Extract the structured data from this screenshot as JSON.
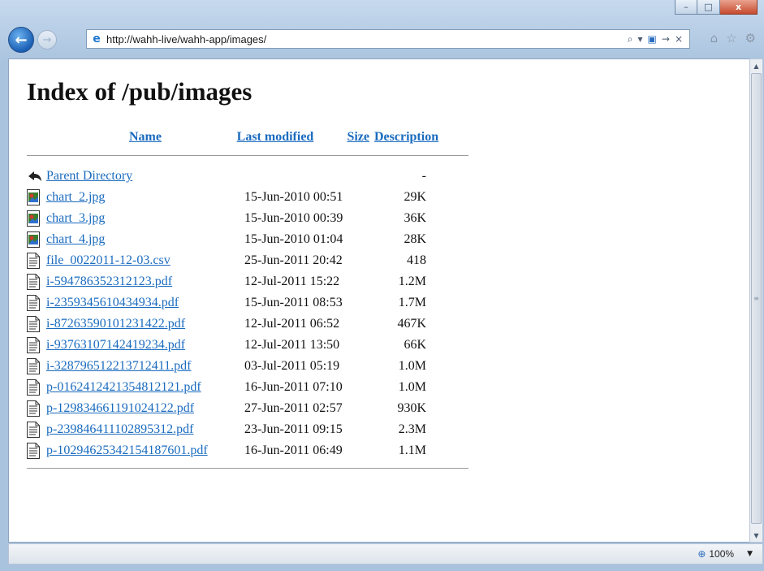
{
  "window": {
    "controls": {
      "minimize": "–",
      "maximize": "□",
      "close": "x"
    }
  },
  "nav": {
    "back_glyph": "←",
    "forward_glyph": "→",
    "address": "http://wahh-live/wahh-app/images/",
    "search_glyph": "⌕",
    "compat_glyph": "▾",
    "refresh_glyph": "→",
    "stop_glyph": "×",
    "home_glyph": "⌂",
    "favorites_glyph": "☆",
    "tools_glyph": "⚙"
  },
  "page": {
    "title": "Index of /pub/images",
    "columns": {
      "name": "Name",
      "modified": "Last modified",
      "size": "Size",
      "description": "Description"
    },
    "parent": {
      "label": "Parent Directory",
      "size": "-"
    },
    "files": [
      {
        "icon": "image",
        "name": "chart_2.jpg",
        "modified": "15-Jun-2010 00:51",
        "size": "29K"
      },
      {
        "icon": "image",
        "name": "chart_3.jpg",
        "modified": "15-Jun-2010 00:39",
        "size": "36K"
      },
      {
        "icon": "image",
        "name": "chart_4.jpg",
        "modified": "15-Jun-2010 01:04",
        "size": "28K"
      },
      {
        "icon": "text",
        "name": "file_0022011-12-03.csv",
        "modified": "25-Jun-2011 20:42",
        "size": "418"
      },
      {
        "icon": "text",
        "name": "i-594786352312123.pdf",
        "modified": "12-Jul-2011 15:22",
        "size": "1.2M"
      },
      {
        "icon": "text",
        "name": "i-2359345610434934.pdf",
        "modified": "15-Jun-2011 08:53",
        "size": "1.7M"
      },
      {
        "icon": "text",
        "name": "i-87263590101231422.pdf",
        "modified": "12-Jul-2011 06:52",
        "size": "467K"
      },
      {
        "icon": "text",
        "name": "i-93763107142419234.pdf",
        "modified": "12-Jul-2011 13:50",
        "size": "66K"
      },
      {
        "icon": "text",
        "name": "i-328796512213712411.pdf",
        "modified": "03-Jul-2011 05:19",
        "size": "1.0M"
      },
      {
        "icon": "text",
        "name": "p-0162412421354812121.pdf",
        "modified": "16-Jun-2011 07:10",
        "size": "1.0M"
      },
      {
        "icon": "text",
        "name": "p-129834661191024122.pdf",
        "modified": "27-Jun-2011 02:57",
        "size": "930K"
      },
      {
        "icon": "text",
        "name": "p-239846411102895312.pdf",
        "modified": "23-Jun-2011 09:15",
        "size": "2.3M"
      },
      {
        "icon": "text",
        "name": "p-10294625342154187601.pdf",
        "modified": "16-Jun-2011 06:49",
        "size": "1.1M"
      }
    ]
  },
  "status": {
    "zoom": "100%"
  },
  "colors": {
    "link": "#1a6bbf",
    "chrome": "#a9c3de",
    "accent": "#1a5fb4"
  }
}
